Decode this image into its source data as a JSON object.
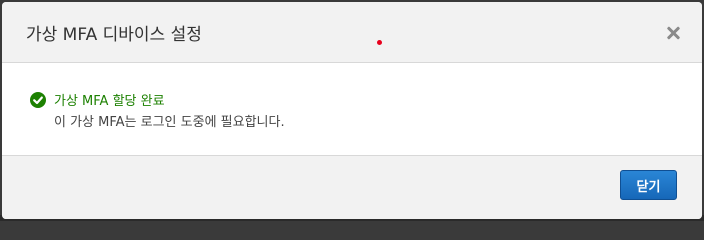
{
  "dialog": {
    "title": "가상 MFA 디바이스 설정",
    "close_icon": "close-icon",
    "message": {
      "icon": "check-circle-icon",
      "title": "가상 MFA 할당 완료",
      "description": "이 가상 MFA는 로그인 도중에 필요합니다."
    },
    "footer": {
      "close_label": "닫기"
    }
  },
  "colors": {
    "success": "#1d8102",
    "primary_button": "#1a73c9",
    "header_bg": "#f2f2f2"
  }
}
